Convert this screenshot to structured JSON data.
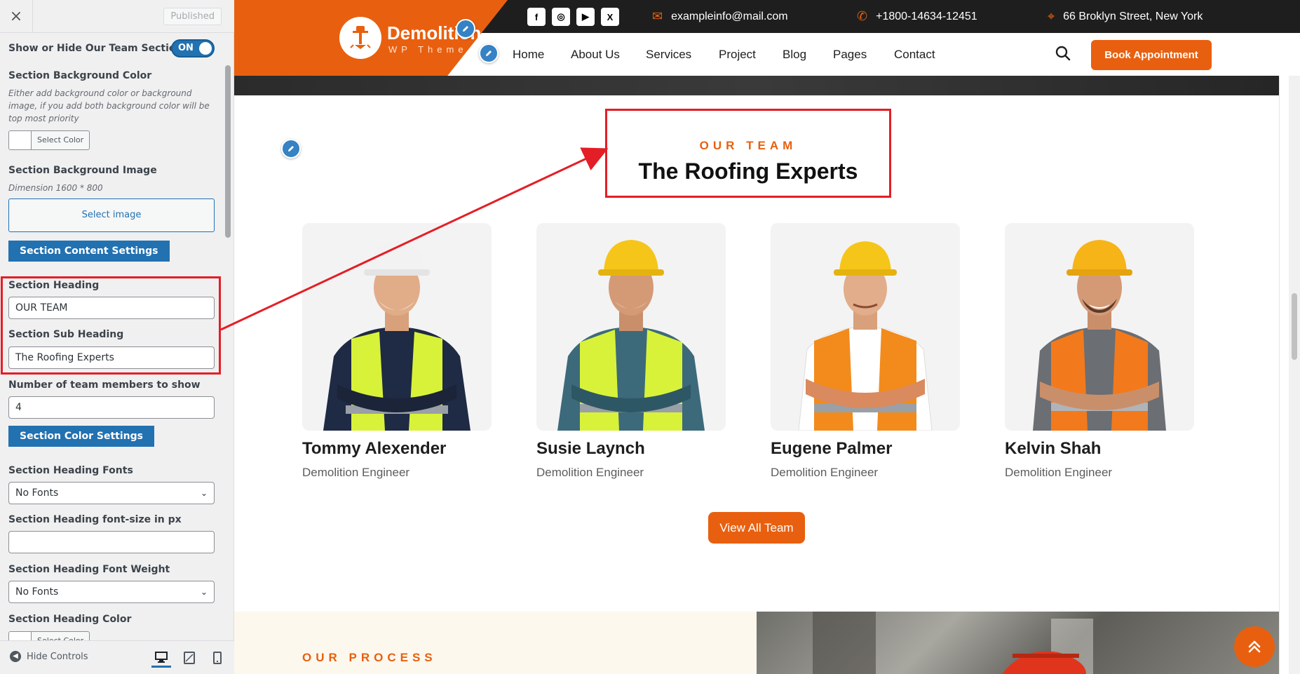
{
  "sidebar": {
    "close_icon": "×",
    "published_label": "Published",
    "toggle_label": "Show or Hide Our Team Section",
    "toggle_value": "ON",
    "bg_color_label": "Section Background Color",
    "bg_color_desc": "Either add background color or background image, if you add both background color will be top most priority",
    "select_color_label": "Select Color",
    "bg_image_label": "Section Background Image",
    "bg_image_desc": "Dimension 1600 * 800",
    "select_image_label": "Select image",
    "content_settings_button": "Section Content Settings",
    "heading_label": "Section Heading",
    "heading_value": "OUR TEAM",
    "subheading_label": "Section Sub Heading",
    "subheading_value": "The Roofing Experts",
    "members_label": "Number of team members to show",
    "members_value": "4",
    "color_settings_button": "Section Color Settings",
    "heading_fonts_label": "Section Heading Fonts",
    "heading_fonts_value": "No Fonts",
    "heading_fontsize_label": "Section Heading font-size in px",
    "heading_fontsize_value": "",
    "heading_weight_label": "Section Heading Font Weight",
    "heading_weight_value": "No Fonts",
    "heading_color_label": "Section Heading Color",
    "heading_color_select": "Select Color",
    "hide_controls_label": "Hide Controls"
  },
  "site": {
    "logo_name": "Demolition",
    "logo_sub": "WP Theme",
    "socials": [
      "f",
      "◎",
      "▶",
      "X"
    ],
    "email": "exampleinfo@mail.com",
    "phone": "+1800-14634-12451",
    "address": "66 Broklyn Street, New York",
    "nav": [
      "Home",
      "About Us",
      "Services",
      "Project",
      "Blog",
      "Pages",
      "Contact"
    ],
    "book_button": "Book Appointment",
    "team_small": "OUR TEAM",
    "team_big": "The Roofing Experts",
    "members": [
      {
        "name": "Tommy Alexender",
        "role": "Demolition Engineer",
        "helmet": "#f2f2f2",
        "vest": "#d8f23a",
        "shirt": "#1f2a44"
      },
      {
        "name": "Susie Laynch",
        "role": "Demolition Engineer",
        "helmet": "#f6c519",
        "vest": "#d8f23a",
        "shirt": "#3c6a7a"
      },
      {
        "name": "Eugene Palmer",
        "role": "Demolition Engineer",
        "helmet": "#f6c519",
        "vest": "#f28b1c",
        "shirt": "#ffffff"
      },
      {
        "name": "Kelvin Shah",
        "role": "Demolition Engineer",
        "helmet": "#f6b419",
        "vest": "#f27a1c",
        "shirt": "#6b6e73"
      }
    ],
    "view_all": "View All Team",
    "process_label": "OUR PROCESS"
  },
  "colors": {
    "accent": "#e8600f",
    "wp_blue": "#2271b1",
    "highlight_red": "#e41e26"
  }
}
